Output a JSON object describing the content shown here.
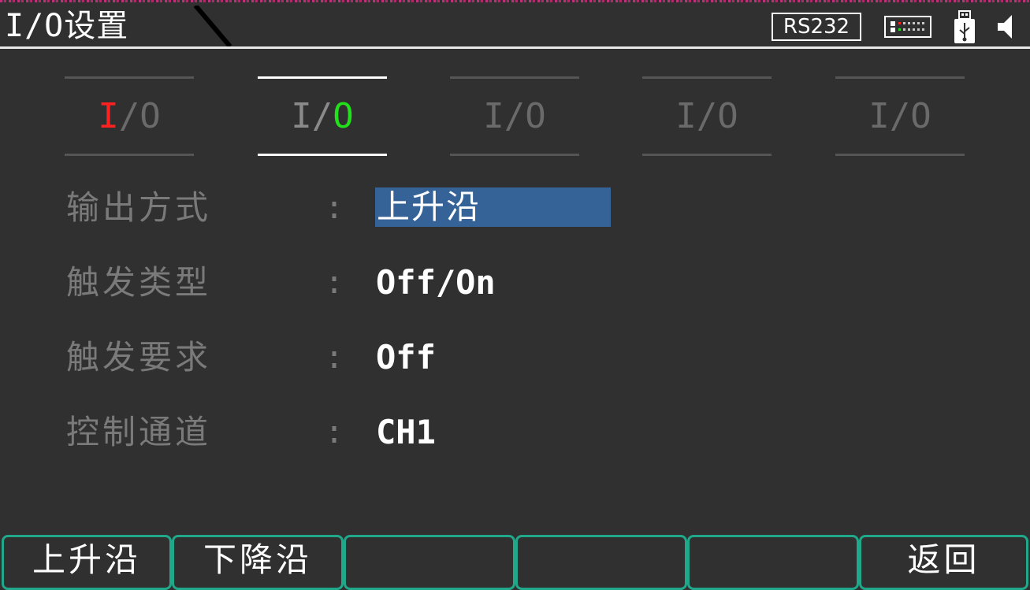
{
  "header": {
    "title": "I/O设置",
    "interface_badge": "RS232",
    "icons": [
      "network-icon",
      "usb-icon",
      "speaker-icon"
    ]
  },
  "tabs": [
    {
      "prefix": "I",
      "rest": "/O",
      "prefix_color": "#ff2020"
    },
    {
      "prefix": "I/",
      "rest": "O",
      "rest_color": "#22e01a",
      "active": true
    },
    {
      "label": "I/O"
    },
    {
      "label": "I/O"
    },
    {
      "label": "I/O"
    }
  ],
  "settings": [
    {
      "label": "输出方式",
      "colon": ":",
      "value": "上升沿",
      "selected": true
    },
    {
      "label": "触发类型",
      "colon": ":",
      "value": "Off/On"
    },
    {
      "label": "触发要求",
      "colon": ":",
      "value": "Off"
    },
    {
      "label": "控制通道",
      "colon": ":",
      "value": "CH1"
    }
  ],
  "softkeys": [
    {
      "label": "上升沿"
    },
    {
      "label": "下降沿"
    },
    {
      "label": ""
    },
    {
      "label": ""
    },
    {
      "label": ""
    },
    {
      "label": "返回"
    }
  ],
  "colors": {
    "background": "#303030",
    "selection": "#356297",
    "softkey_border": "#1fa98a",
    "accent_red": "#ff2020",
    "accent_green": "#22e01a"
  }
}
